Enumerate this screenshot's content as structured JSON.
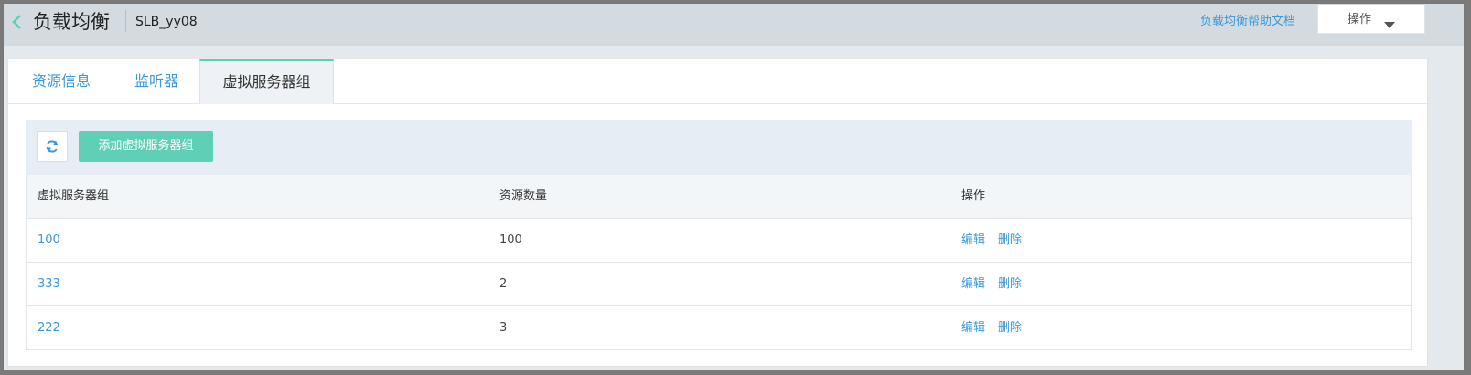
{
  "header": {
    "title": "负载均衡",
    "subtitle": "SLB_yy08",
    "help_link": "负载均衡帮助文档",
    "ops_label": "操作"
  },
  "tabs": [
    {
      "label": "资源信息",
      "active": false
    },
    {
      "label": "监听器",
      "active": false
    },
    {
      "label": "虚拟服务器组",
      "active": true
    }
  ],
  "toolbar": {
    "add_label": "添加虚拟服务器组"
  },
  "table": {
    "columns": [
      "虚拟服务器组",
      "资源数量",
      "操作"
    ],
    "rows": [
      {
        "name": "100",
        "count": "100",
        "edit": "编辑",
        "delete": "删除"
      },
      {
        "name": "333",
        "count": "2",
        "edit": "编辑",
        "delete": "删除"
      },
      {
        "name": "222",
        "count": "3",
        "edit": "编辑",
        "delete": "删除"
      }
    ]
  },
  "colors": {
    "accent": "#5fd0b5",
    "link": "#3a98d8",
    "header_bg": "#d3dbe1"
  },
  "icons": {
    "back": "chevron-left-icon",
    "dropdown": "caret-down-icon",
    "refresh": "refresh-icon"
  }
}
